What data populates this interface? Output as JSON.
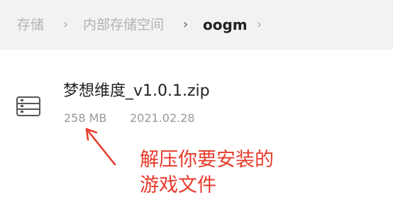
{
  "breadcrumb": {
    "items": [
      "存储",
      "内部存储空间",
      "oogm"
    ]
  },
  "file": {
    "icon": "archive-file-icon",
    "name": "梦想维度_v1.0.1.zip",
    "size": "258 MB",
    "date": "2021.02.28"
  },
  "annotation": {
    "color": "#e8392b",
    "lines": [
      "解压你要安装的",
      "游戏文件"
    ]
  }
}
